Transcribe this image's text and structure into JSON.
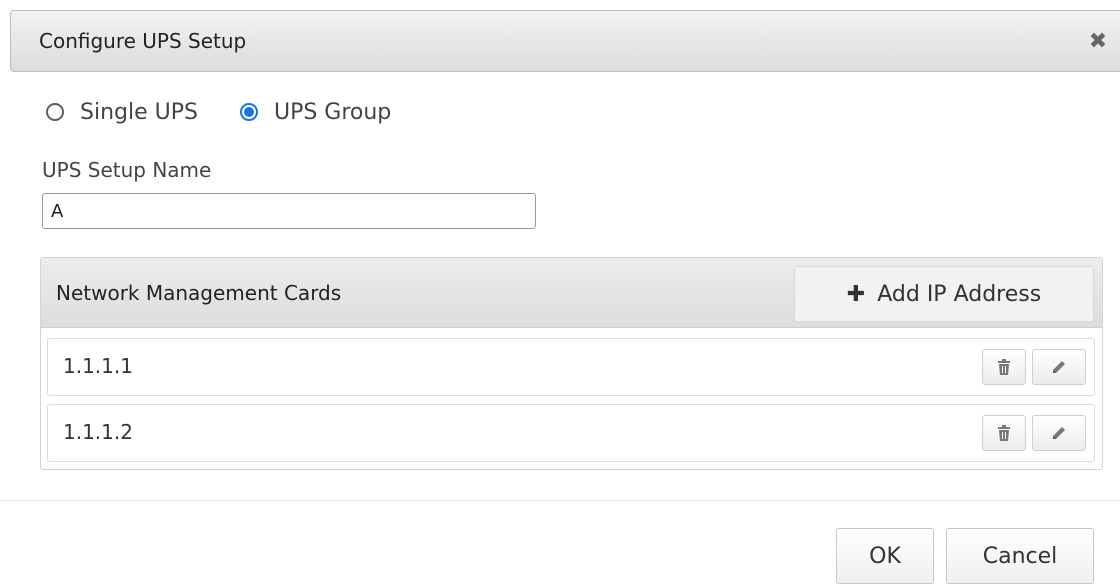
{
  "dialog": {
    "title": "Configure UPS Setup",
    "close_icon": "close-icon"
  },
  "setup_type": {
    "options": [
      {
        "label": "Single UPS",
        "checked": false
      },
      {
        "label": "UPS Group",
        "checked": true
      }
    ]
  },
  "setup_name": {
    "label": "UPS Setup Name",
    "value": "A"
  },
  "nmc_panel": {
    "title": "Network Management Cards",
    "add_button_label": "Add IP Address",
    "add_icon": "plus-icon",
    "rows": [
      {
        "ip": "1.1.1.1",
        "delete_icon": "trash-icon",
        "edit_icon": "pencil-icon"
      },
      {
        "ip": "1.1.1.2",
        "delete_icon": "trash-icon",
        "edit_icon": "pencil-icon"
      }
    ]
  },
  "footer": {
    "ok_label": "OK",
    "cancel_label": "Cancel"
  },
  "colors": {
    "accent": "#1a73e8",
    "header_bg": "#dcdcdc"
  }
}
